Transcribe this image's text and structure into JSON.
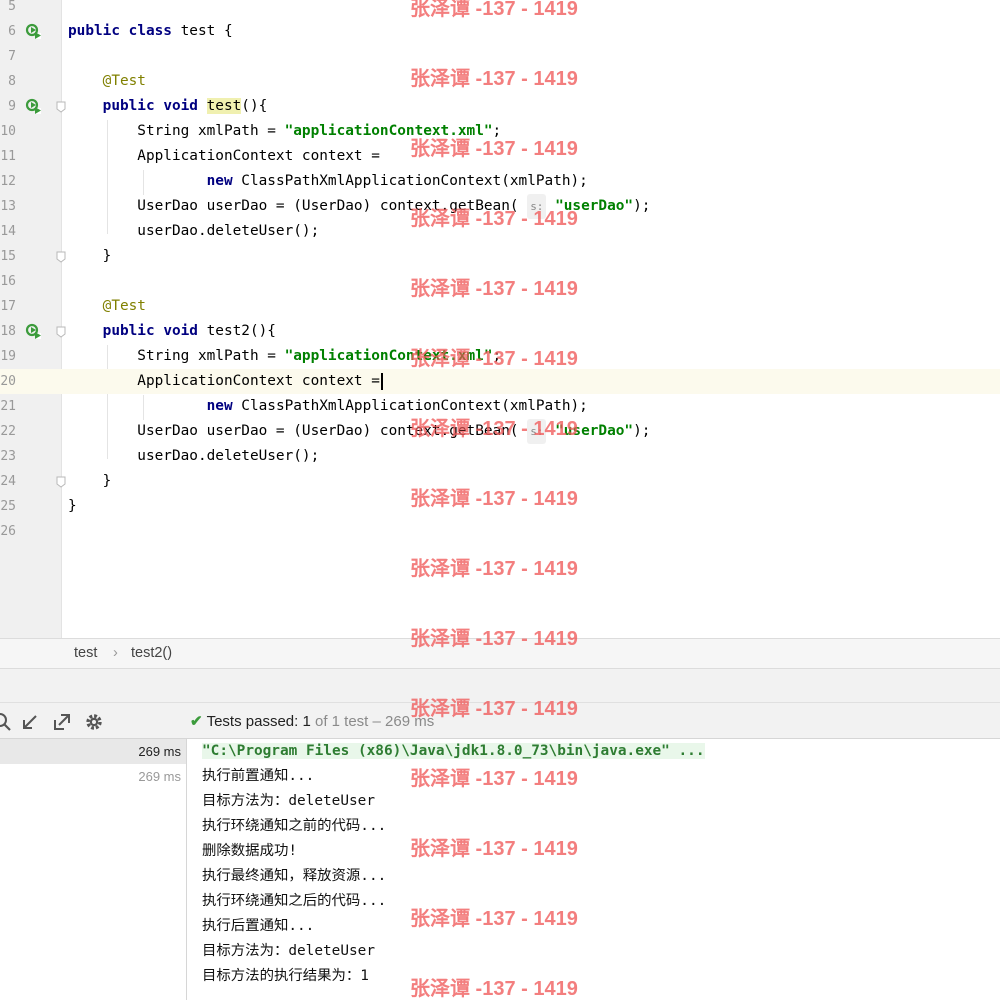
{
  "editor": {
    "lines": [
      {
        "num": "5"
      },
      {
        "num": "6",
        "run": true,
        "segs": [
          {
            "t": "public",
            "c": "kw"
          },
          {
            "t": " "
          },
          {
            "t": "class",
            "c": "kw"
          },
          {
            "t": " test {"
          }
        ]
      },
      {
        "num": "7"
      },
      {
        "num": "8",
        "segs": [
          {
            "t": "    "
          },
          {
            "t": "@Test",
            "c": "ann"
          }
        ]
      },
      {
        "num": "9",
        "run": true,
        "fold": true,
        "segs": [
          {
            "t": "    "
          },
          {
            "t": "public",
            "c": "kw"
          },
          {
            "t": " "
          },
          {
            "t": "void",
            "c": "kw"
          },
          {
            "t": " "
          },
          {
            "t": "test",
            "c": "hl"
          },
          {
            "t": "(){"
          }
        ]
      },
      {
        "num": "10",
        "segs": [
          {
            "t": "        String xmlPath = "
          },
          {
            "t": "\"applicationContext.xml\"",
            "c": "str"
          },
          {
            "t": ";"
          }
        ]
      },
      {
        "num": "11",
        "segs": [
          {
            "t": "        ApplicationContext context ="
          }
        ]
      },
      {
        "num": "12",
        "segs": [
          {
            "t": "                "
          },
          {
            "t": "new",
            "c": "kw"
          },
          {
            "t": " ClassPathXmlApplicationContext(xmlPath);"
          }
        ]
      },
      {
        "num": "13",
        "segs": [
          {
            "t": "        UserDao userDao = (UserDao) context.getBean( "
          },
          {
            "t": "s:",
            "c": "hint"
          },
          {
            "t": " "
          },
          {
            "t": "\"userDao\"",
            "c": "str"
          },
          {
            "t": ");"
          }
        ]
      },
      {
        "num": "14",
        "segs": [
          {
            "t": "        userDao.deleteUser();"
          }
        ]
      },
      {
        "num": "15",
        "fold": true,
        "segs": [
          {
            "t": "    }"
          }
        ]
      },
      {
        "num": "16"
      },
      {
        "num": "17",
        "segs": [
          {
            "t": "    "
          },
          {
            "t": "@Test",
            "c": "ann"
          }
        ]
      },
      {
        "num": "18",
        "run": true,
        "fold": true,
        "segs": [
          {
            "t": "    "
          },
          {
            "t": "public",
            "c": "kw"
          },
          {
            "t": " "
          },
          {
            "t": "void",
            "c": "kw"
          },
          {
            "t": " test2(){"
          }
        ]
      },
      {
        "num": "19",
        "segs": [
          {
            "t": "        String xmlPath = "
          },
          {
            "t": "\"applicationContext.xml\"",
            "c": "str"
          },
          {
            "t": ";"
          }
        ]
      },
      {
        "num": "20",
        "current": true,
        "segs": [
          {
            "t": "        ApplicationContext context ="
          },
          {
            "t": "",
            "c": "caret"
          }
        ]
      },
      {
        "num": "21",
        "segs": [
          {
            "t": "                "
          },
          {
            "t": "new",
            "c": "kw"
          },
          {
            "t": " ClassPathXmlApplicationContext(xmlPath);"
          }
        ]
      },
      {
        "num": "22",
        "segs": [
          {
            "t": "        UserDao userDao = (UserDao) context.getBean( "
          },
          {
            "t": "s:",
            "c": "hint"
          },
          {
            "t": " "
          },
          {
            "t": "\"userDao\"",
            "c": "str"
          },
          {
            "t": ");"
          }
        ]
      },
      {
        "num": "23",
        "segs": [
          {
            "t": "        userDao.deleteUser();"
          }
        ]
      },
      {
        "num": "24",
        "fold": true,
        "segs": [
          {
            "t": "    }"
          }
        ]
      },
      {
        "num": "25",
        "segs": [
          {
            "t": "}"
          }
        ]
      },
      {
        "num": "26"
      }
    ]
  },
  "breadcrumb": {
    "class": "test",
    "separator": "›",
    "method": "test2()"
  },
  "run": {
    "status_label": "Tests passed:",
    "status_count": "1",
    "status_rest": "of 1 test – 269 ms",
    "tree": [
      {
        "time": "269 ms",
        "selected": true
      },
      {
        "time": "269 ms",
        "selected": false
      }
    ],
    "console": [
      "\"C:\\Program Files (x86)\\Java\\jdk1.8.0_73\\bin\\java.exe\" ...",
      "执行前置通知...",
      "目标方法为：deleteUser",
      "执行环绕通知之前的代码...",
      "删除数据成功!",
      "执行最终通知，释放资源...",
      "执行环绕通知之后的代码...",
      "执行后置通知...",
      "目标方法为：deleteUser",
      "目标方法的执行结果为：1"
    ]
  },
  "watermark": {
    "text": "张泽谭 -137 - 1419"
  },
  "colors": {
    "keyword": "#000080",
    "annotation": "#808000",
    "string": "#008000",
    "watermark": "#f05a5a",
    "pass": "#3c9b3c"
  }
}
